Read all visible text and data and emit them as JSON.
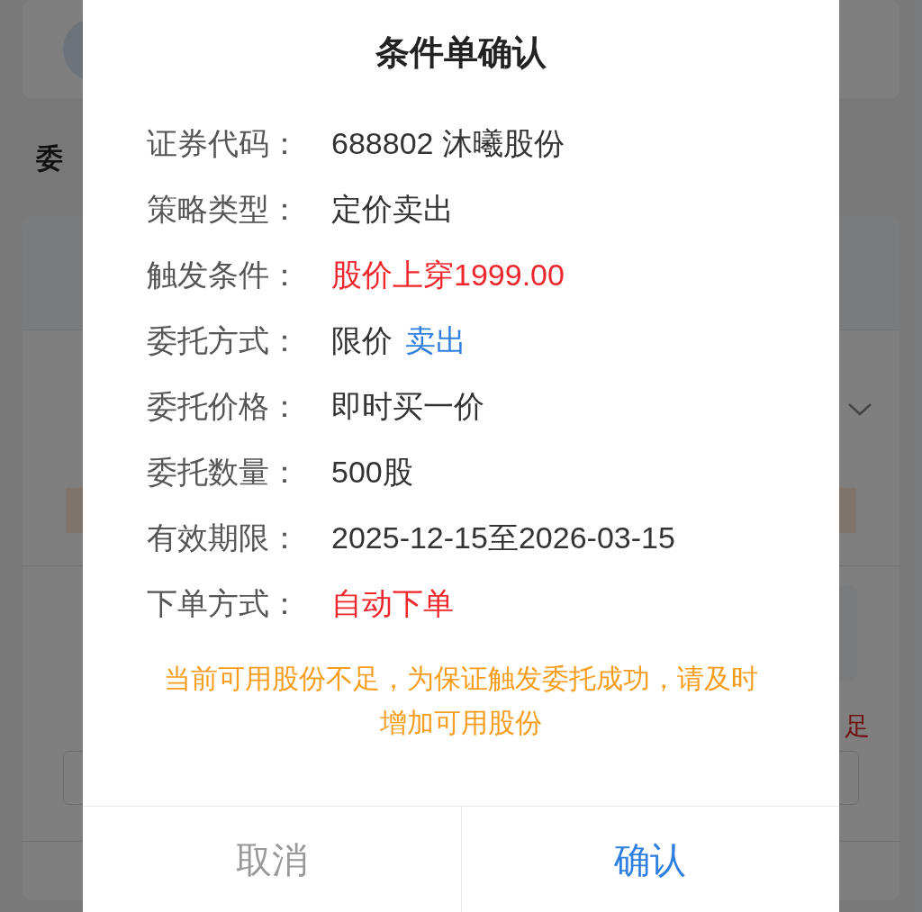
{
  "background": {
    "section_heading": "委",
    "warning_fragment": "足"
  },
  "dialog": {
    "title": "条件单确认",
    "rows": [
      {
        "label": "证券代码：",
        "value": [
          {
            "text": "688802 沐曦股份",
            "color": "#333333"
          }
        ]
      },
      {
        "label": "策略类型：",
        "value": [
          {
            "text": "定价卖出",
            "color": "#333333"
          }
        ]
      },
      {
        "label": "触发条件：",
        "value": [
          {
            "text": "股价上穿1999.00",
            "color": "#f0262d"
          }
        ]
      },
      {
        "label": "委托方式：",
        "value": [
          {
            "text": "限价",
            "color": "#333333"
          },
          {
            "text": "卖出",
            "color": "#2f7fe0"
          }
        ]
      },
      {
        "label": "委托价格：",
        "value": [
          {
            "text": "即时买一价",
            "color": "#333333"
          }
        ]
      },
      {
        "label": "委托数量：",
        "value": [
          {
            "text": "500股",
            "color": "#333333"
          }
        ]
      },
      {
        "label": "有效期限：",
        "value": [
          {
            "text": "2025-12-15至2026-03-15",
            "color": "#333333"
          }
        ]
      },
      {
        "label": "下单方式：",
        "value": [
          {
            "text": "自动下单",
            "color": "#f0262d"
          }
        ]
      }
    ],
    "warning": "当前可用股份不足，为保证触发委托成功，请及时增加可用股份",
    "buttons": [
      {
        "label": "取消",
        "kind": "cancel"
      },
      {
        "label": "确认",
        "kind": "confirm"
      }
    ]
  }
}
